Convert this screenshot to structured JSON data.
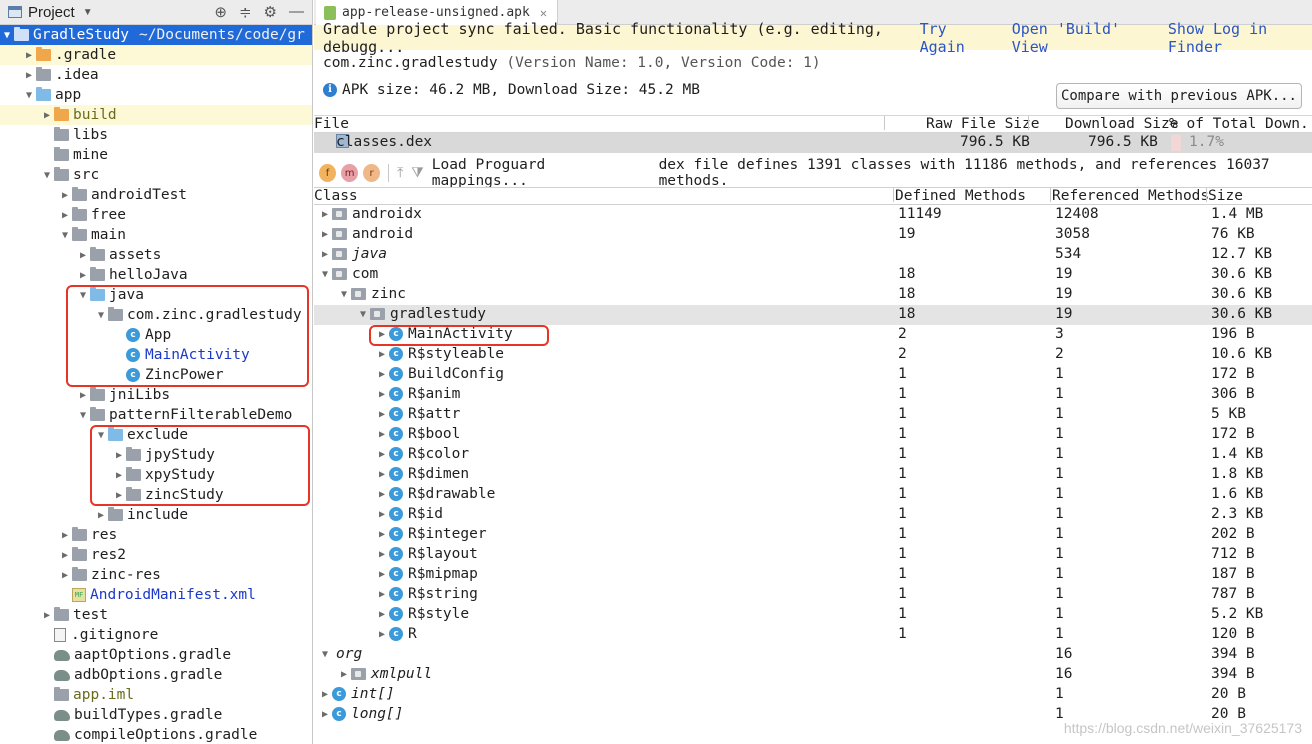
{
  "project_panel": {
    "title": "Project",
    "root": {
      "label": "GradleStudy",
      "path": "~/Documents/code/gr"
    },
    "items": [
      {
        "label": ".gradle",
        "depth": 1,
        "expand": "closed",
        "icon": "folder-orange",
        "highlight": true
      },
      {
        "label": ".idea",
        "depth": 1,
        "expand": "closed",
        "icon": "folder"
      },
      {
        "label": "app",
        "depth": 1,
        "expand": "open",
        "icon": "module"
      },
      {
        "label": "build",
        "depth": 2,
        "expand": "closed",
        "icon": "folder-orange",
        "highlight": true,
        "style": "olive"
      },
      {
        "label": "libs",
        "depth": 2,
        "expand": "none",
        "icon": "folder"
      },
      {
        "label": "mine",
        "depth": 2,
        "expand": "none",
        "icon": "folder"
      },
      {
        "label": "src",
        "depth": 2,
        "expand": "open",
        "icon": "folder"
      },
      {
        "label": "androidTest",
        "depth": 3,
        "expand": "closed",
        "icon": "folder"
      },
      {
        "label": "free",
        "depth": 3,
        "expand": "closed",
        "icon": "folder"
      },
      {
        "label": "main",
        "depth": 3,
        "expand": "open",
        "icon": "folder"
      },
      {
        "label": "assets",
        "depth": 4,
        "expand": "closed",
        "icon": "folder-res"
      },
      {
        "label": "helloJava",
        "depth": 4,
        "expand": "closed",
        "icon": "folder"
      },
      {
        "label": "java",
        "depth": 4,
        "expand": "open",
        "icon": "folder-blue"
      },
      {
        "label": "com.zinc.gradlestudy",
        "depth": 5,
        "expand": "open",
        "icon": "package"
      },
      {
        "label": "App",
        "depth": 6,
        "expand": "none",
        "icon": "class"
      },
      {
        "label": "MainActivity",
        "depth": 6,
        "expand": "none",
        "icon": "class",
        "style": "blue"
      },
      {
        "label": "ZincPower",
        "depth": 6,
        "expand": "none",
        "icon": "class"
      },
      {
        "label": "jniLibs",
        "depth": 4,
        "expand": "closed",
        "icon": "folder"
      },
      {
        "label": "patternFilterableDemo",
        "depth": 4,
        "expand": "open",
        "icon": "folder"
      },
      {
        "label": "exclude",
        "depth": 5,
        "expand": "open",
        "icon": "folder-blue"
      },
      {
        "label": "jpyStudy",
        "depth": 6,
        "expand": "closed",
        "icon": "package"
      },
      {
        "label": "xpyStudy",
        "depth": 6,
        "expand": "closed",
        "icon": "package"
      },
      {
        "label": "zincStudy",
        "depth": 6,
        "expand": "closed",
        "icon": "package"
      },
      {
        "label": "include",
        "depth": 5,
        "expand": "closed",
        "icon": "folder"
      },
      {
        "label": "res",
        "depth": 3,
        "expand": "closed",
        "icon": "folder"
      },
      {
        "label": "res2",
        "depth": 3,
        "expand": "closed",
        "icon": "folder"
      },
      {
        "label": "zinc-res",
        "depth": 3,
        "expand": "closed",
        "icon": "folder-res"
      },
      {
        "label": "AndroidManifest.xml",
        "depth": 3,
        "expand": "none",
        "icon": "manifest",
        "style": "blue"
      },
      {
        "label": "test",
        "depth": 2,
        "expand": "closed",
        "icon": "folder"
      },
      {
        "label": ".gitignore",
        "depth": 2,
        "expand": "none",
        "icon": "file"
      },
      {
        "label": "aaptOptions.gradle",
        "depth": 2,
        "expand": "none",
        "icon": "gradle"
      },
      {
        "label": "adbOptions.gradle",
        "depth": 2,
        "expand": "none",
        "icon": "gradle"
      },
      {
        "label": "app.iml",
        "depth": 2,
        "expand": "none",
        "icon": "iml",
        "style": "olive"
      },
      {
        "label": "buildTypes.gradle",
        "depth": 2,
        "expand": "none",
        "icon": "gradle"
      },
      {
        "label": "compileOptions.gradle",
        "depth": 2,
        "expand": "none",
        "icon": "gradle"
      }
    ]
  },
  "editor_tab": {
    "label": "app-release-unsigned.apk"
  },
  "banner": {
    "message": "Gradle project sync failed. Basic functionality (e.g. editing, debugg...",
    "links": [
      "Try Again",
      "Open 'Build' View",
      "Show Log in Finder"
    ]
  },
  "apk_info": {
    "package": "com.zinc.gradlestudy",
    "version": "(Version Name: 1.0, Version Code: 1)",
    "size_text": "APK size: 46.2 MB, Download Size: 45.2 MB",
    "compare_button": "Compare with previous APK..."
  },
  "file_table": {
    "headers": [
      "File",
      "Raw File Size",
      "Download Size",
      "% of Total Down..."
    ],
    "row": {
      "name": "classes.dex",
      "raw": "796.5 KB",
      "download": "796.5 KB",
      "percent": "1.7%",
      "percent_fraction": 0.017
    }
  },
  "dex_toolbar": {
    "load_label": "Load Proguard mappings...",
    "summary": "dex file defines 1391 classes with 11186 methods, and references 16037 methods."
  },
  "class_table": {
    "headers": [
      "Class",
      "Defined Methods",
      "Referenced Methods",
      "Size"
    ],
    "rows": [
      {
        "name": "androidx",
        "depth": 0,
        "expand": "closed",
        "icon": "package",
        "defined": "11149",
        "referenced": "12408",
        "size": "1.4 MB"
      },
      {
        "name": "android",
        "depth": 0,
        "expand": "closed",
        "icon": "package",
        "defined": "19",
        "referenced": "3058",
        "size": "76 KB"
      },
      {
        "name": "java",
        "depth": 0,
        "expand": "closed",
        "icon": "package",
        "italic": true,
        "defined": "",
        "referenced": "534",
        "size": "12.7 KB"
      },
      {
        "name": "com",
        "depth": 0,
        "expand": "open",
        "icon": "package",
        "defined": "18",
        "referenced": "19",
        "size": "30.6 KB"
      },
      {
        "name": "zinc",
        "depth": 1,
        "expand": "open",
        "icon": "package",
        "defined": "18",
        "referenced": "19",
        "size": "30.6 KB"
      },
      {
        "name": "gradlestudy",
        "depth": 2,
        "expand": "open",
        "icon": "package",
        "highlight": true,
        "defined": "18",
        "referenced": "19",
        "size": "30.6 KB"
      },
      {
        "name": "MainActivity",
        "depth": 3,
        "expand": "closed",
        "icon": "class",
        "defined": "2",
        "referenced": "3",
        "size": "196 B"
      },
      {
        "name": "R$styleable",
        "depth": 3,
        "expand": "closed",
        "icon": "class",
        "defined": "2",
        "referenced": "2",
        "size": "10.6 KB"
      },
      {
        "name": "BuildConfig",
        "depth": 3,
        "expand": "closed",
        "icon": "class",
        "defined": "1",
        "referenced": "1",
        "size": "172 B"
      },
      {
        "name": "R$anim",
        "depth": 3,
        "expand": "closed",
        "icon": "class",
        "defined": "1",
        "referenced": "1",
        "size": "306 B"
      },
      {
        "name": "R$attr",
        "depth": 3,
        "expand": "closed",
        "icon": "class",
        "defined": "1",
        "referenced": "1",
        "size": "5 KB"
      },
      {
        "name": "R$bool",
        "depth": 3,
        "expand": "closed",
        "icon": "class",
        "defined": "1",
        "referenced": "1",
        "size": "172 B"
      },
      {
        "name": "R$color",
        "depth": 3,
        "expand": "closed",
        "icon": "class",
        "defined": "1",
        "referenced": "1",
        "size": "1.4 KB"
      },
      {
        "name": "R$dimen",
        "depth": 3,
        "expand": "closed",
        "icon": "class",
        "defined": "1",
        "referenced": "1",
        "size": "1.8 KB"
      },
      {
        "name": "R$drawable",
        "depth": 3,
        "expand": "closed",
        "icon": "class",
        "defined": "1",
        "referenced": "1",
        "size": "1.6 KB"
      },
      {
        "name": "R$id",
        "depth": 3,
        "expand": "closed",
        "icon": "class",
        "defined": "1",
        "referenced": "1",
        "size": "2.3 KB"
      },
      {
        "name": "R$integer",
        "depth": 3,
        "expand": "closed",
        "icon": "class",
        "defined": "1",
        "referenced": "1",
        "size": "202 B"
      },
      {
        "name": "R$layout",
        "depth": 3,
        "expand": "closed",
        "icon": "class",
        "defined": "1",
        "referenced": "1",
        "size": "712 B"
      },
      {
        "name": "R$mipmap",
        "depth": 3,
        "expand": "closed",
        "icon": "class",
        "defined": "1",
        "referenced": "1",
        "size": "187 B"
      },
      {
        "name": "R$string",
        "depth": 3,
        "expand": "closed",
        "icon": "class",
        "defined": "1",
        "referenced": "1",
        "size": "787 B"
      },
      {
        "name": "R$style",
        "depth": 3,
        "expand": "closed",
        "icon": "class",
        "defined": "1",
        "referenced": "1",
        "size": "5.2 KB"
      },
      {
        "name": "R",
        "depth": 3,
        "expand": "closed",
        "icon": "class",
        "defined": "1",
        "referenced": "1",
        "size": "120 B"
      },
      {
        "name": "org",
        "depth": 0,
        "expand": "open",
        "icon": "none",
        "italic": true,
        "defined": "",
        "referenced": "16",
        "size": "394 B"
      },
      {
        "name": "xmlpull",
        "depth": 1,
        "expand": "closed",
        "icon": "package",
        "italic": true,
        "defined": "",
        "referenced": "16",
        "size": "394 B"
      },
      {
        "name": "int[]",
        "depth": 0,
        "expand": "closed",
        "icon": "class",
        "italic": true,
        "defined": "",
        "referenced": "1",
        "size": "20 B"
      },
      {
        "name": "long[]",
        "depth": 0,
        "expand": "closed",
        "icon": "class",
        "italic": true,
        "defined": "",
        "referenced": "1",
        "size": "20 B"
      }
    ]
  },
  "watermark": "https://blog.csdn.net/weixin_37625173",
  "colors": {
    "selection": "#1f6ad8",
    "banner_bg": "#fdf6d2",
    "link": "#2a55c8",
    "annotation_box": "#e53526"
  }
}
